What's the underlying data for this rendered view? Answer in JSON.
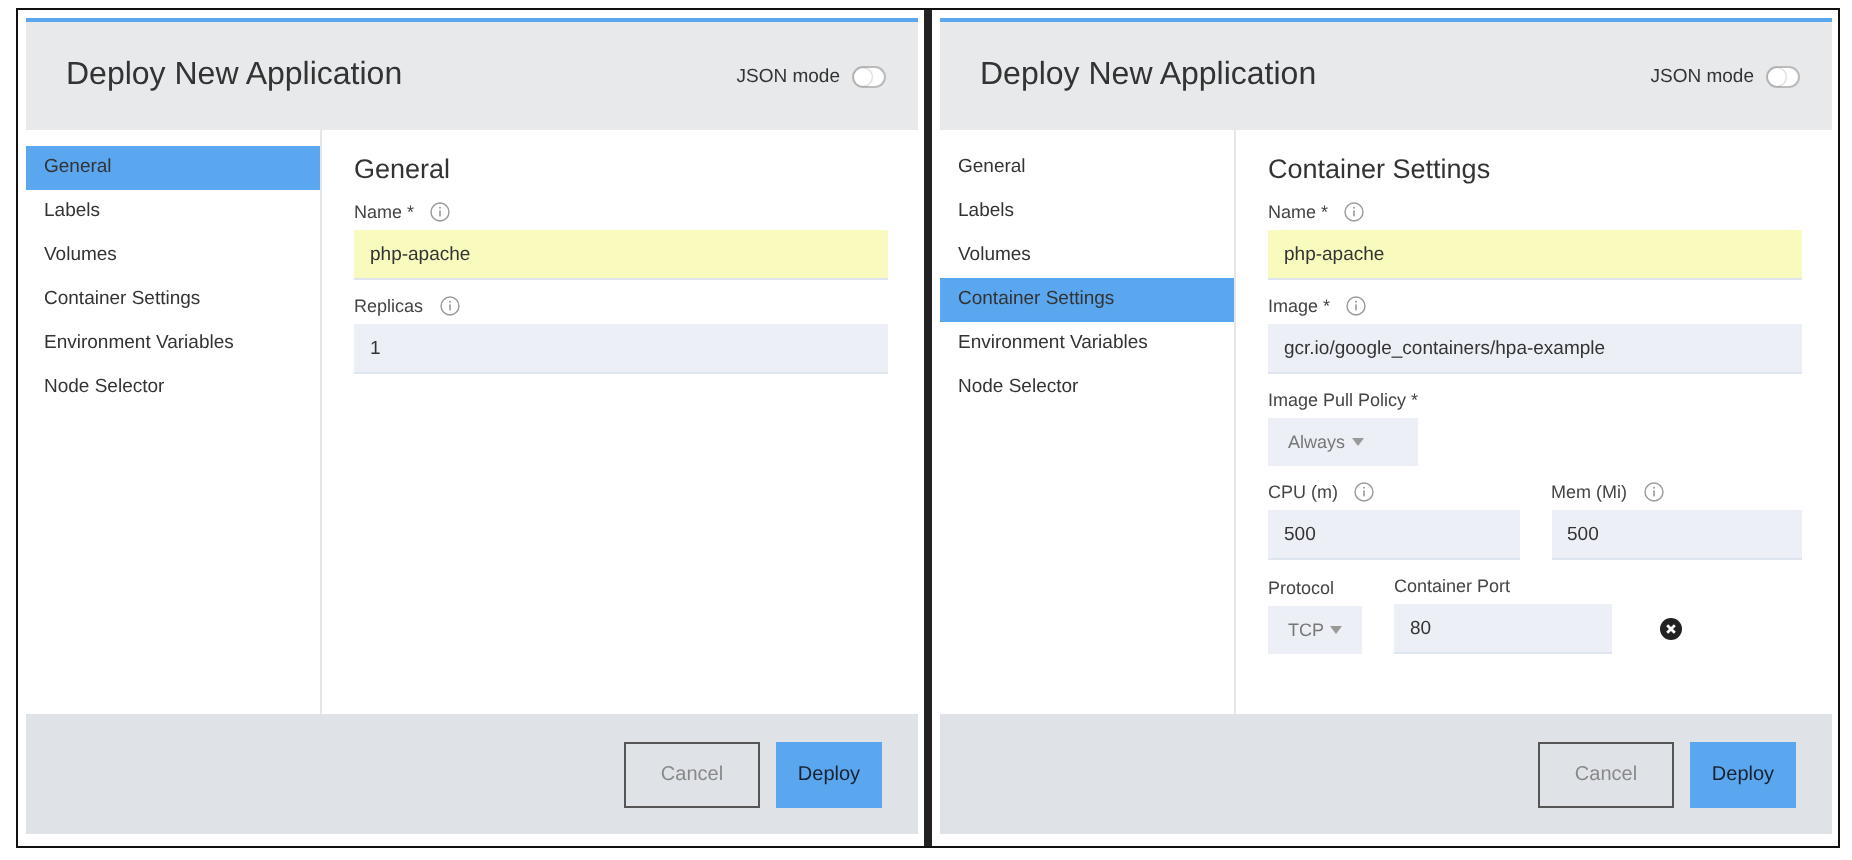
{
  "dialogs": [
    {
      "title": "Deploy New Application",
      "json_mode": {
        "label": "JSON mode",
        "on": false
      },
      "nav": [
        {
          "label": "General",
          "selected": true
        },
        {
          "label": "Labels",
          "selected": false
        },
        {
          "label": "Volumes",
          "selected": false
        },
        {
          "label": "Container Settings",
          "selected": false
        },
        {
          "label": "Environment Variables",
          "selected": false
        },
        {
          "label": "Node Selector",
          "selected": false
        }
      ],
      "section_title": "General",
      "rows": [
        [
          {
            "kind": "text",
            "label": "Name *",
            "info": true,
            "value": "php-apache",
            "highlighted": true
          }
        ],
        [
          {
            "kind": "text",
            "label": "Replicas",
            "info": true,
            "value": "1",
            "highlighted": false
          }
        ]
      ],
      "buttons": [
        {
          "label": "Cancel",
          "kind": "secondary"
        },
        {
          "label": "Deploy",
          "kind": "primary"
        }
      ]
    },
    {
      "title": "Deploy New Application",
      "json_mode": {
        "label": "JSON mode",
        "on": false
      },
      "nav": [
        {
          "label": "General",
          "selected": false
        },
        {
          "label": "Labels",
          "selected": false
        },
        {
          "label": "Volumes",
          "selected": false
        },
        {
          "label": "Container Settings",
          "selected": true
        },
        {
          "label": "Environment Variables",
          "selected": false
        },
        {
          "label": "Node Selector",
          "selected": false
        }
      ],
      "section_title": "Container Settings",
      "rows": [
        [
          {
            "kind": "text",
            "label": "Name *",
            "info": true,
            "value": "php-apache",
            "highlighted": true
          }
        ],
        [
          {
            "kind": "text",
            "label": "Image *",
            "info": true,
            "value": "gcr.io/google_containers/hpa-example",
            "highlighted": false
          }
        ],
        [
          {
            "kind": "select",
            "label": "Image Pull Policy *",
            "value": "Always"
          }
        ],
        [
          {
            "kind": "text",
            "label": "CPU (m)",
            "info": true,
            "value": "500",
            "highlighted": false
          },
          {
            "kind": "text",
            "label": "Mem (Mi)",
            "info": true,
            "value": "500",
            "highlighted": false
          }
        ],
        [
          {
            "kind": "select",
            "label": "Protocol",
            "value": "TCP"
          },
          {
            "kind": "text",
            "label": "Container Port",
            "info": false,
            "value": "80",
            "highlighted": false
          },
          {
            "kind": "remove"
          }
        ]
      ],
      "buttons": [
        {
          "label": "Cancel",
          "kind": "secondary"
        },
        {
          "label": "Deploy",
          "kind": "primary"
        }
      ]
    }
  ]
}
